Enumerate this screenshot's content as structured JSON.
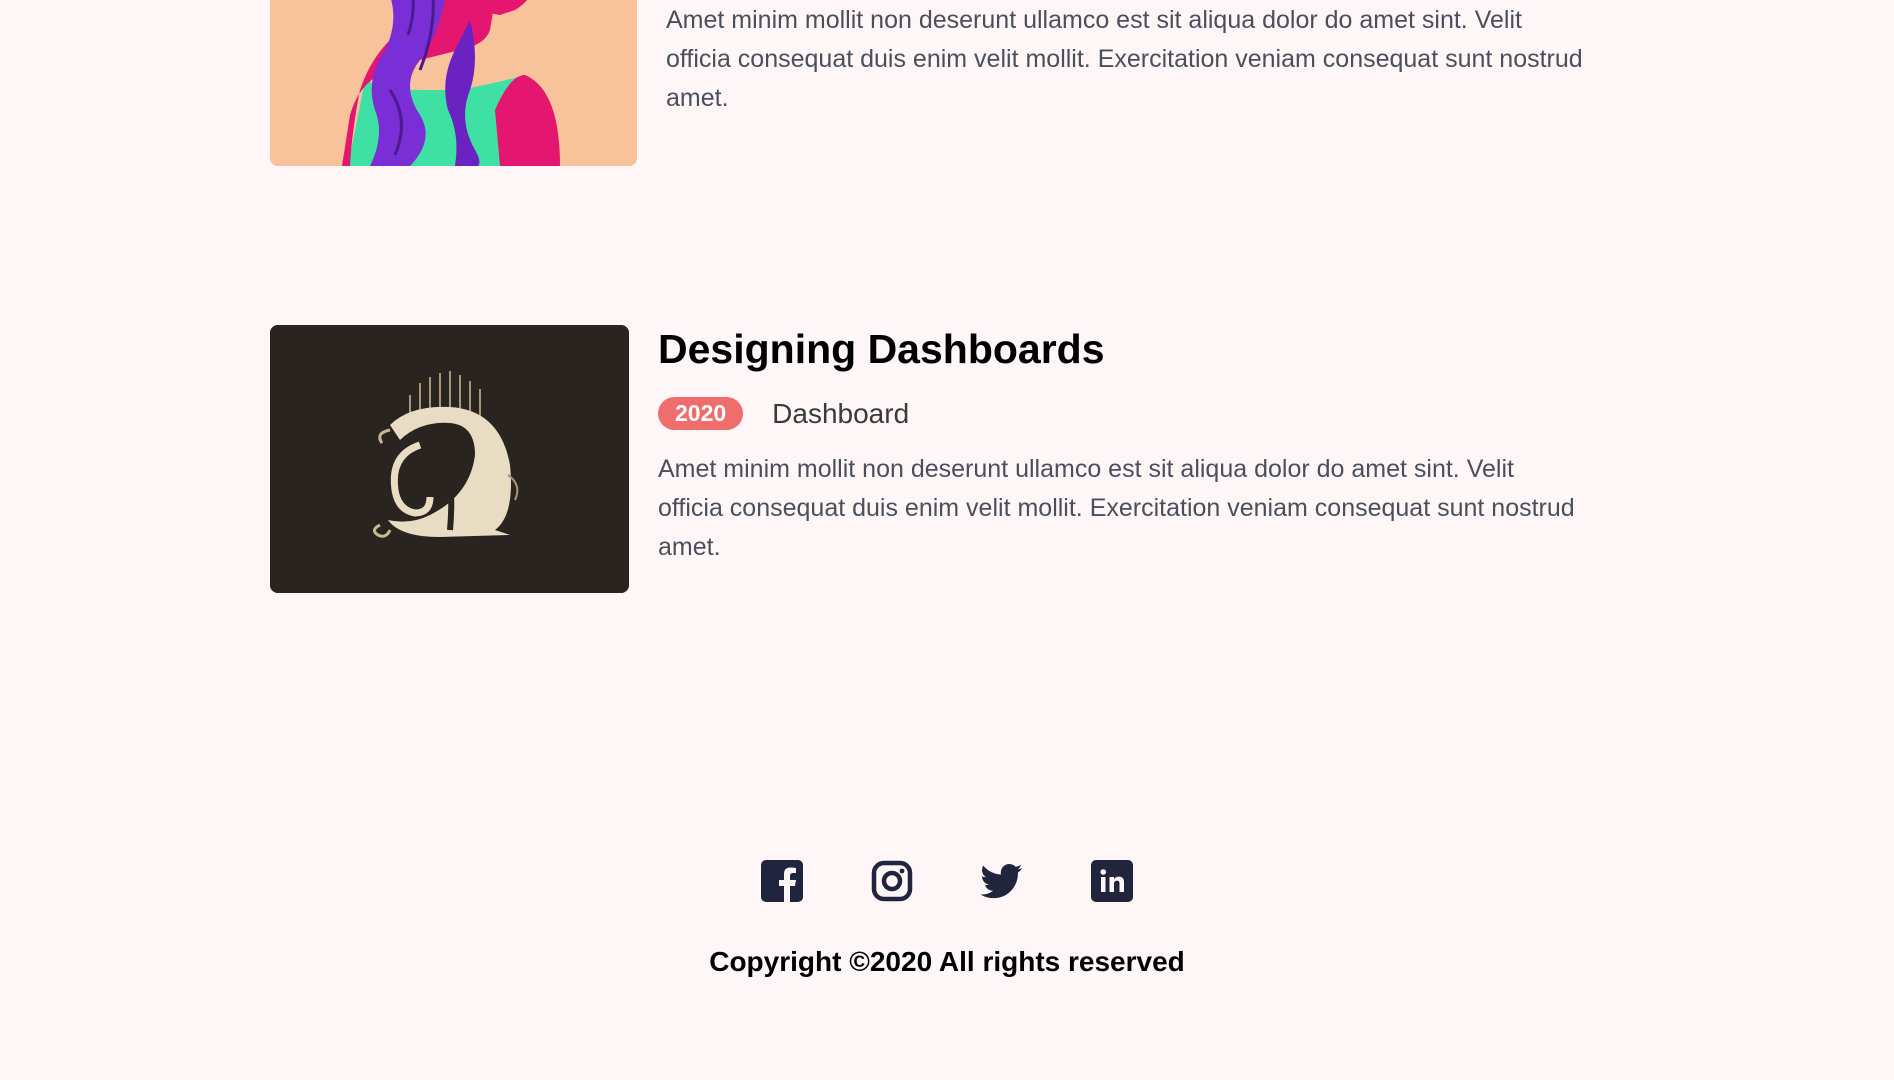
{
  "works": [
    {
      "title": "",
      "year": "",
      "category": "",
      "description": "Amet minim mollit non deserunt ullamco est sit aliqua dolor do amet sint. Velit officia consequat duis enim velit mollit. Exercitation veniam consequat sunt nostrud amet.",
      "thumbnail": "illustration of woman with purple hair"
    },
    {
      "title": "Designing Dashboards",
      "year": "2020",
      "category": "Dashboard",
      "description": "Amet minim mollit non deserunt ullamco est sit aliqua dolor do amet sint. Velit officia consequat duis enim velit mollit. Exercitation veniam consequat sunt nostrud amet.",
      "thumbnail": "ornamental letter D on dark background"
    }
  ],
  "footer": {
    "social": [
      {
        "name": "facebook",
        "icon": "facebook-icon"
      },
      {
        "name": "instagram",
        "icon": "instagram-icon"
      },
      {
        "name": "twitter",
        "icon": "twitter-icon"
      },
      {
        "name": "linkedin",
        "icon": "linkedin-icon"
      }
    ],
    "copyright": "Copyright ©2020 All rights reserved"
  },
  "colors": {
    "background": "#fff7f7",
    "accent": "#f06d6d",
    "icon": "#21243d"
  }
}
